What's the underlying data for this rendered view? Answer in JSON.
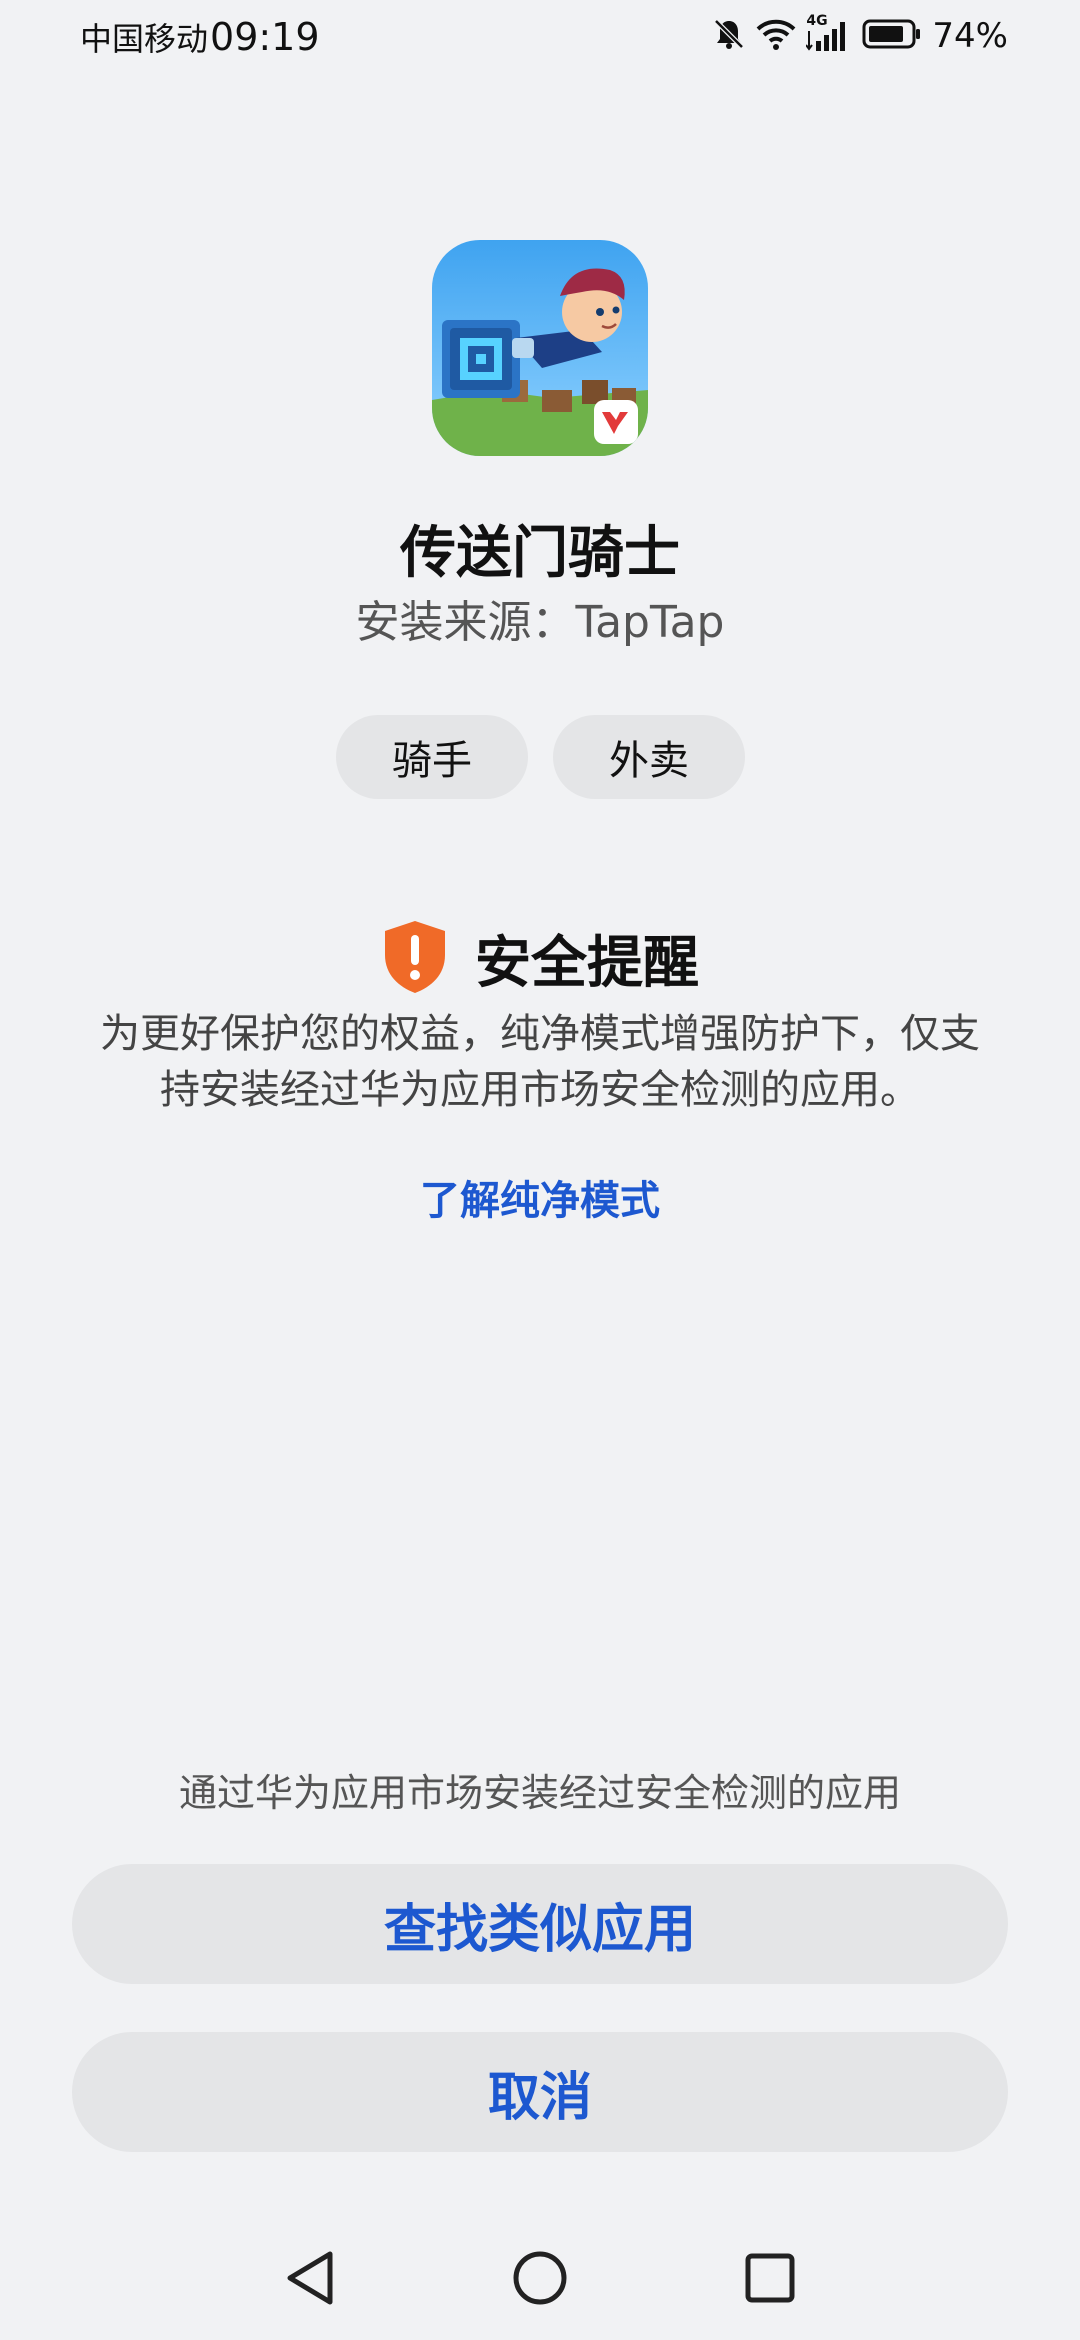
{
  "status_bar": {
    "carrier": "中国移动",
    "time": "09:19",
    "network": "4G",
    "battery": "74%"
  },
  "app": {
    "name": "传送门骑士",
    "source": "安装来源：TapTap",
    "icon": "game-app-icon"
  },
  "tags": [
    "骑手",
    "外卖"
  ],
  "security_notice": {
    "title": "安全提醒",
    "icon": "shield-warning-icon",
    "body_line1": "为更好保护您的权益，纯净模式增强防护下，仅支",
    "body_line2": "持安装经过华为应用市场安全检测的应用。",
    "learn_more": "了解纯净模式"
  },
  "bottom": {
    "hint": "通过华为应用市场安装经过安全检测的应用",
    "find_similar": "查找类似应用",
    "cancel": "取消"
  },
  "colors": {
    "background": "#f1f2f4",
    "accent": "#1d58d0",
    "warning": "#f06a28",
    "button_bg": "#e4e5e7"
  }
}
